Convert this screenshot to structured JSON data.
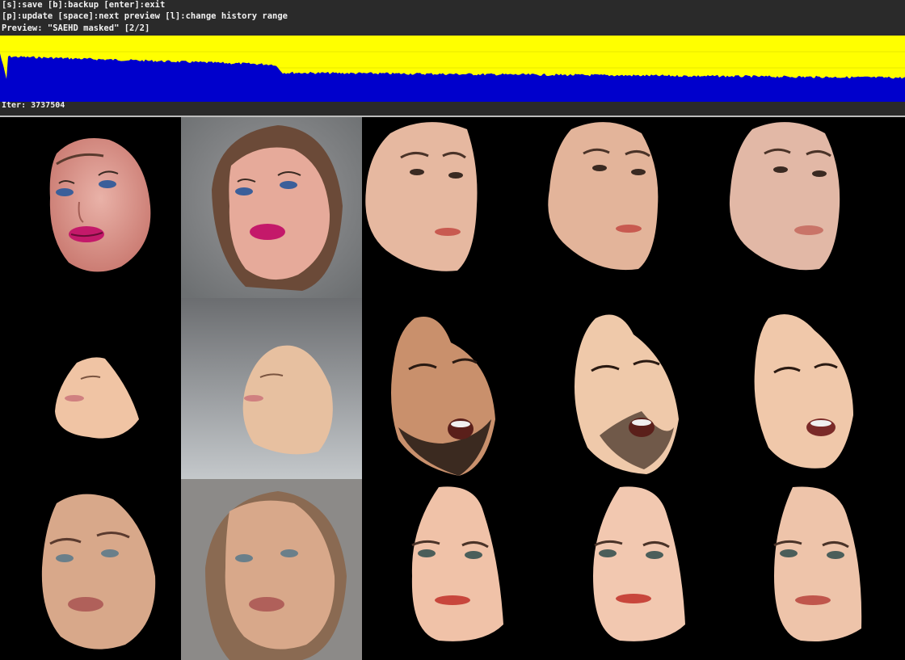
{
  "window": {
    "help_line_1": "[s]:save [b]:backup [enter]:exit",
    "help_line_2": "[p]:update [space]:next preview [l]:change history range",
    "preview_line": "Preview: \"SAEHD masked\" [2/2]",
    "iter_label": "Iter: 3737504"
  },
  "history_graph": {
    "series": [
      {
        "color": "#ffff00"
      },
      {
        "color": "#0000cc"
      }
    ]
  },
  "colors": {
    "header_bg": "#2a2a2a",
    "graph_yellow": "#ffff00",
    "graph_blue": "#0000cc",
    "separator": "#bdbdbd",
    "preview_bg": "#000000"
  },
  "preview_grid": {
    "rows": [
      {
        "cells": [
          "face-src-masked",
          "face-src-recon",
          "face-dst-masked",
          "face-dst-recon",
          "face-swap"
        ]
      },
      {
        "cells": [
          "face-src-masked",
          "face-src-recon",
          "face-dst-masked",
          "face-dst-recon",
          "face-swap"
        ]
      },
      {
        "cells": [
          "face-src-masked",
          "face-src-recon",
          "face-dst-masked",
          "face-dst-recon",
          "face-swap"
        ]
      }
    ]
  }
}
